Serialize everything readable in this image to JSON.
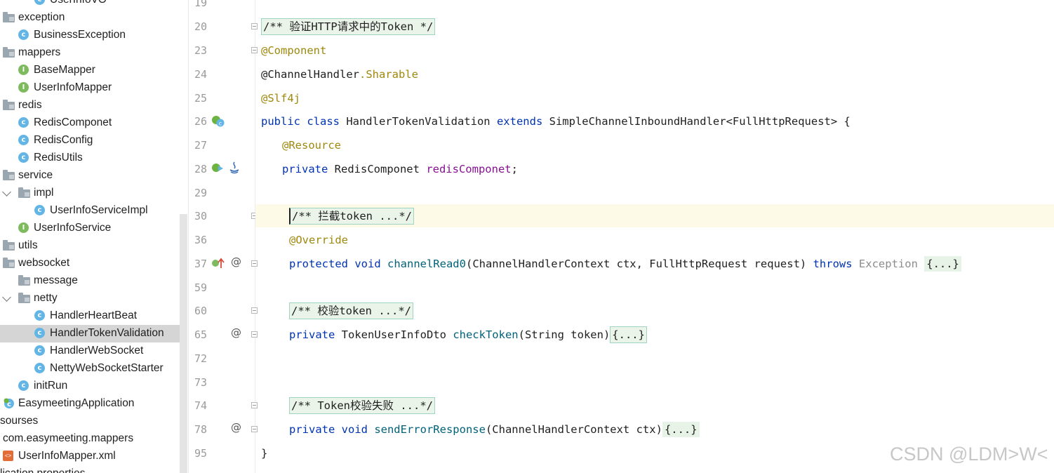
{
  "tree": {
    "items": [
      {
        "label": "UserInfoVO",
        "kind": "class"
      },
      {
        "label": "exception",
        "kind": "folder"
      },
      {
        "label": "BusinessException",
        "kind": "class"
      },
      {
        "label": "mappers",
        "kind": "folder"
      },
      {
        "label": "BaseMapper",
        "kind": "interface"
      },
      {
        "label": "UserInfoMapper",
        "kind": "interface"
      },
      {
        "label": "redis",
        "kind": "folder"
      },
      {
        "label": "RedisComponet",
        "kind": "class"
      },
      {
        "label": "RedisConfig",
        "kind": "class"
      },
      {
        "label": "RedisUtils",
        "kind": "class"
      },
      {
        "label": "service",
        "kind": "folder"
      },
      {
        "label": "impl",
        "kind": "folder",
        "expanded": true
      },
      {
        "label": "UserInfoServiceImpl",
        "kind": "class"
      },
      {
        "label": "UserInfoService",
        "kind": "interface"
      },
      {
        "label": "utils",
        "kind": "folder"
      },
      {
        "label": "websocket",
        "kind": "folder"
      },
      {
        "label": "message",
        "kind": "folder"
      },
      {
        "label": "netty",
        "kind": "folder",
        "expanded": true
      },
      {
        "label": "HandlerHeartBeat",
        "kind": "class"
      },
      {
        "label": "HandlerTokenValidation",
        "kind": "class",
        "selected": true
      },
      {
        "label": "HandlerWebSocket",
        "kind": "class"
      },
      {
        "label": "NettyWebSocketStarter",
        "kind": "class"
      },
      {
        "label": "initRun",
        "kind": "class"
      },
      {
        "label": "EasymeetingApplication",
        "kind": "app"
      },
      {
        "label": "sourses",
        "kind": "text"
      },
      {
        "label": "com.easymeeting.mappers",
        "kind": "text"
      },
      {
        "label": "UserInfoMapper.xml",
        "kind": "xml"
      },
      {
        "label": "lication.properties",
        "kind": "text"
      }
    ]
  },
  "gutter": {
    "line_numbers": [
      "19",
      "20",
      "23",
      "24",
      "25",
      "26",
      "27",
      "28",
      "29",
      "30",
      "36",
      "37",
      "59",
      "60",
      "65",
      "72",
      "73",
      "74",
      "78",
      "95"
    ]
  },
  "code": {
    "c20": "/** 验证HTTP请求中的Token */",
    "c23": "@Component",
    "c24a": "@ChannelHandler",
    "c24b": ".Sharable",
    "c25": "@Slf4j",
    "c26a": "public class",
    "c26b": " HandlerTokenValidation ",
    "c26c": "extends",
    "c26d": " SimpleChannelInboundHandler<FullHttpRequest> {",
    "c27": "@Resource",
    "c28a": "private",
    "c28b": " RedisComponet ",
    "c28c": "redisComponet",
    "c28d": ";",
    "c30": "/** 拦截token ...*/",
    "c36": "@Override",
    "c37a": "protected void",
    "c37b": " channelRead0",
    "c37c": "(ChannelHandlerContext ctx, FullHttpRequest request) ",
    "c37d": "throws",
    "c37e": " Exception ",
    "c37f": "{...}",
    "c60": "/** 校验token ...*/",
    "c65a": "private",
    "c65b": " TokenUserInfoDto ",
    "c65c": "checkToken",
    "c65d": "(String token)",
    "c65e": "{...}",
    "c74": "/** Token校验失败 ...*/",
    "c78a": "private void",
    "c78b": " sendErrorResponse",
    "c78c": "(ChannelHandlerContext ctx)",
    "c78d": "{...}",
    "c95": "}"
  },
  "watermark": "CSDN @LDM>W<",
  "colors": {
    "keyword": "#0033b3",
    "annotation": "#9e880d",
    "field": "#871094",
    "method": "#00627a",
    "fold_box": "#9fd3c2"
  }
}
